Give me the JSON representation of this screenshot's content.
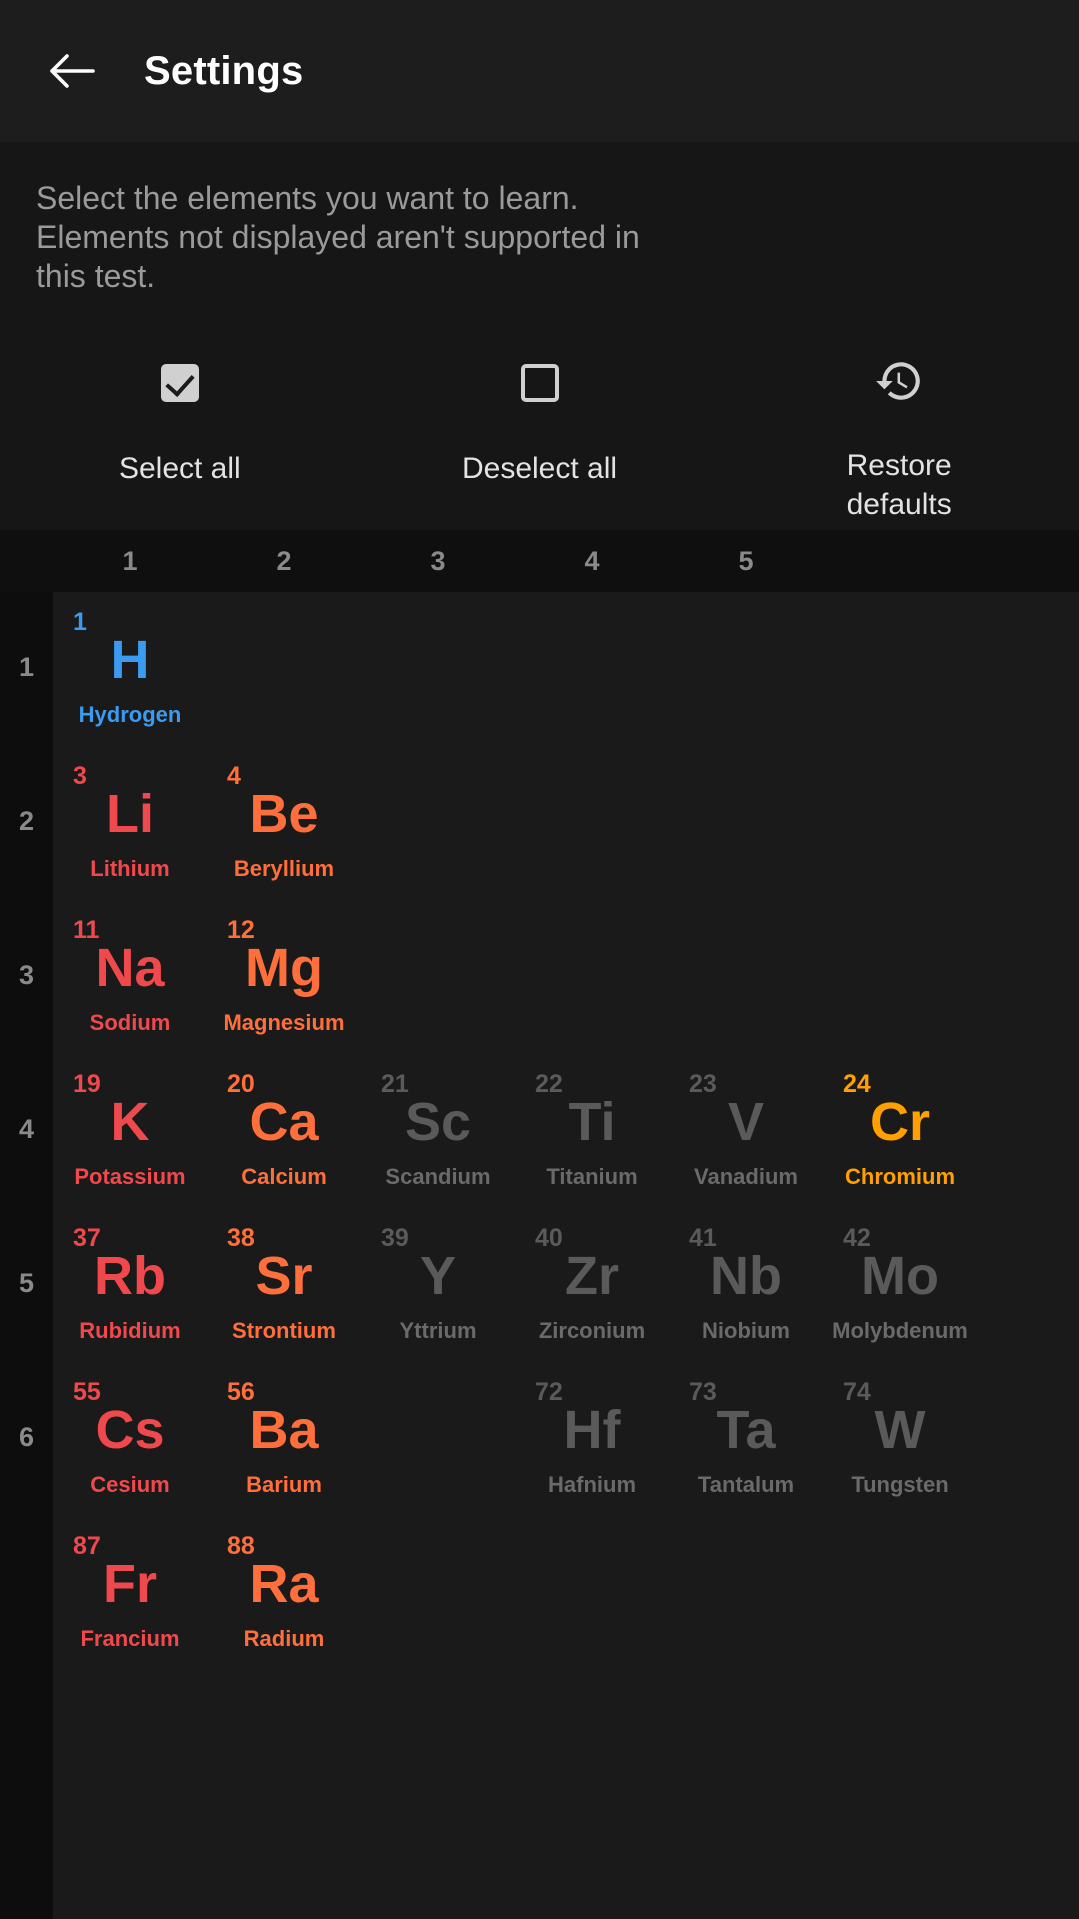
{
  "appbar": {
    "back_icon": "arrow-left-icon",
    "title": "Settings"
  },
  "description": {
    "line1": "Select the elements you want to learn.",
    "line2": "Elements not displayed aren't supported in",
    "line3": "this test."
  },
  "actions": [
    {
      "id": "select-all",
      "label": "Select all",
      "icon": "checkbox-checked-icon"
    },
    {
      "id": "deselect-all",
      "label": "Deselect all",
      "icon": "checkbox-empty-icon"
    },
    {
      "id": "restore-defaults",
      "label": "Restore defaults",
      "icon": "history-restore-icon"
    }
  ],
  "table": {
    "column_headers": [
      "1",
      "2",
      "3",
      "4",
      "5"
    ],
    "row_headers": [
      "1",
      "2",
      "3",
      "4",
      "5",
      "6"
    ],
    "colors": {
      "alkali_metal": "#F0494D",
      "alkaline_earth": "#FF6F3C",
      "nonmetal_hydrogen": "#3B9BF0",
      "transition_selected": "#FFA000",
      "deselected": "#5a5a5a",
      "deselected_name": "#6a6a6a",
      "grid_bg": "#1a1a1a",
      "gutter_bg": "#0d0d0d",
      "appbar_bg": "#1d1d1d",
      "panel_bg": "#161616"
    },
    "elements": [
      {
        "num": "1",
        "sym": "H",
        "name": "Hydrogen",
        "group": 1,
        "period": 1,
        "state": "selected",
        "color": "#3B9BF0"
      },
      {
        "num": "3",
        "sym": "Li",
        "name": "Lithium",
        "group": 1,
        "period": 2,
        "state": "selected",
        "color": "#F0494D"
      },
      {
        "num": "4",
        "sym": "Be",
        "name": "Beryllium",
        "group": 2,
        "period": 2,
        "state": "selected",
        "color": "#FF6F3C"
      },
      {
        "num": "11",
        "sym": "Na",
        "name": "Sodium",
        "group": 1,
        "period": 3,
        "state": "selected",
        "color": "#F0494D"
      },
      {
        "num": "12",
        "sym": "Mg",
        "name": "Magnesium",
        "group": 2,
        "period": 3,
        "state": "selected",
        "color": "#FF6F3C"
      },
      {
        "num": "19",
        "sym": "K",
        "name": "Potassium",
        "group": 1,
        "period": 4,
        "state": "selected",
        "color": "#F0494D"
      },
      {
        "num": "20",
        "sym": "Ca",
        "name": "Calcium",
        "group": 2,
        "period": 4,
        "state": "selected",
        "color": "#FF6F3C"
      },
      {
        "num": "21",
        "sym": "Sc",
        "name": "Scandium",
        "group": 3,
        "period": 4,
        "state": "deselected",
        "color": "#5a5a5a"
      },
      {
        "num": "22",
        "sym": "Ti",
        "name": "Titanium",
        "group": 4,
        "period": 4,
        "state": "deselected",
        "color": "#5a5a5a"
      },
      {
        "num": "23",
        "sym": "V",
        "name": "Vanadium",
        "group": 5,
        "period": 4,
        "state": "deselected",
        "color": "#5a5a5a"
      },
      {
        "num": "24",
        "sym": "Cr",
        "name": "Chromium",
        "group": 6,
        "period": 4,
        "state": "selected",
        "color": "#FFA000"
      },
      {
        "num": "37",
        "sym": "Rb",
        "name": "Rubidium",
        "group": 1,
        "period": 5,
        "state": "selected",
        "color": "#F0494D"
      },
      {
        "num": "38",
        "sym": "Sr",
        "name": "Strontium",
        "group": 2,
        "period": 5,
        "state": "selected",
        "color": "#FF6F3C"
      },
      {
        "num": "39",
        "sym": "Y",
        "name": "Yttrium",
        "group": 3,
        "period": 5,
        "state": "deselected",
        "color": "#5a5a5a"
      },
      {
        "num": "40",
        "sym": "Zr",
        "name": "Zirconium",
        "group": 4,
        "period": 5,
        "state": "deselected",
        "color": "#5a5a5a"
      },
      {
        "num": "41",
        "sym": "Nb",
        "name": "Niobium",
        "group": 5,
        "period": 5,
        "state": "deselected",
        "color": "#5a5a5a"
      },
      {
        "num": "42",
        "sym": "Mo",
        "name": "Molybdenum",
        "group": 6,
        "period": 5,
        "state": "deselected",
        "color": "#5a5a5a"
      },
      {
        "num": "55",
        "sym": "Cs",
        "name": "Cesium",
        "group": 1,
        "period": 6,
        "state": "selected",
        "color": "#F0494D"
      },
      {
        "num": "56",
        "sym": "Ba",
        "name": "Barium",
        "group": 2,
        "period": 6,
        "state": "selected",
        "color": "#FF6F3C"
      },
      {
        "num": "72",
        "sym": "Hf",
        "name": "Hafnium",
        "group": 4,
        "period": 6,
        "state": "deselected",
        "color": "#5a5a5a"
      },
      {
        "num": "73",
        "sym": "Ta",
        "name": "Tantalum",
        "group": 5,
        "period": 6,
        "state": "deselected",
        "color": "#5a5a5a"
      },
      {
        "num": "74",
        "sym": "W",
        "name": "Tungsten",
        "group": 6,
        "period": 6,
        "state": "deselected",
        "color": "#5a5a5a"
      },
      {
        "num": "87",
        "sym": "Fr",
        "name": "Francium",
        "group": 1,
        "period": 7,
        "state": "selected",
        "color": "#F0494D"
      },
      {
        "num": "88",
        "sym": "Ra",
        "name": "Radium",
        "group": 2,
        "period": 7,
        "state": "selected",
        "color": "#FF6F3C"
      }
    ]
  }
}
